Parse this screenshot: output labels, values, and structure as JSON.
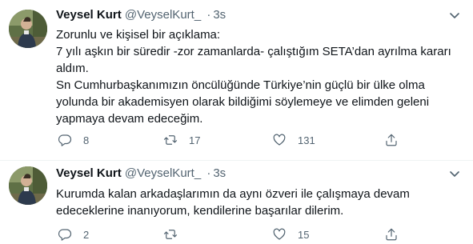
{
  "tweets": [
    {
      "name": "Veysel Kurt",
      "handle": "@VeyselKurt_",
      "separator": "·",
      "time": "3s",
      "lines": [
        "Zorunlu ve kişisel bir açıklama:",
        "7 yılı aşkın bir süredir -zor zamanlarda- çalıştığım SETA’dan ayrılma kararı",
        "aldım.",
        "Sn Cumhurbaşkanımızın öncülüğünde Türkiye’nin güçlü bir ülke olma",
        "yolunda bir akademisyen olarak bildiğimi söylemeye ve elimden geleni",
        "yapmaya devam edeceğim."
      ],
      "replies": "8",
      "retweets": "17",
      "likes": "131"
    },
    {
      "name": "Veysel Kurt",
      "handle": "@VeyselKurt_",
      "separator": "·",
      "time": "3s",
      "lines": [
        "Kurumda kalan arkadaşlarımın da aynı özveri ile çalışmaya devam",
        "edeceklerine inanıyorum, kendilerine başarılar dilerim."
      ],
      "replies": "2",
      "retweets": "",
      "likes": "15"
    }
  ],
  "icons": {
    "reply": "reply-icon",
    "retweet": "retweet-icon",
    "like": "like-icon",
    "share": "share-icon",
    "more": "chevron-down-icon"
  },
  "colors": {
    "text": "#0f1419",
    "secondary": "#536471",
    "divider": "#eff3f4"
  }
}
